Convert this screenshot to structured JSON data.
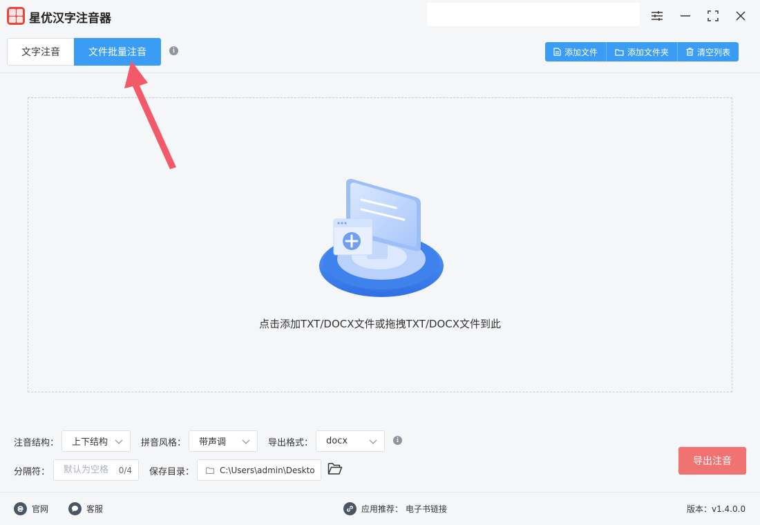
{
  "app": {
    "title": "星优汉字注音器"
  },
  "tabs": [
    {
      "label": "文字注音",
      "active": false
    },
    {
      "label": "文件批量注音",
      "active": true
    }
  ],
  "toolbar": {
    "add_file": "添加文件",
    "add_folder": "添加文件夹",
    "clear_list": "清空列表"
  },
  "dropzone": {
    "hint": "点击添加TXT/DOCX文件或拖拽TXT/DOCX文件到此"
  },
  "settings": {
    "structure_label": "注音结构：",
    "structure_value": "上下结构",
    "style_label": "拼音风格：",
    "style_value": "带声调",
    "format_label": "导出格式：",
    "format_value": "docx",
    "separator_label": "分隔符：",
    "separator_placeholder": "默认为空格",
    "separator_count": "0/4",
    "save_dir_label": "保存目录：",
    "save_dir_value": "C:\\Users\\admin\\Deskto",
    "export_button": "导出注音"
  },
  "footer": {
    "website": "官网",
    "support": "客服",
    "recommend_label": "应用推荐：",
    "recommend_value": "电子书链接",
    "version": "版本：v1.4.0.0"
  },
  "colors": {
    "accent": "#3a9cf5",
    "export": "#f07371",
    "annotation_arrow": "#f25a6a",
    "logo": "#e8473f"
  }
}
